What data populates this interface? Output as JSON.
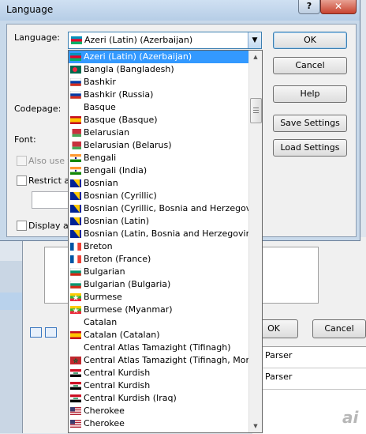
{
  "dialog": {
    "title": "Language",
    "help_glyph": "?",
    "close_glyph": "✕",
    "language_label": "Language:",
    "codepage_label": "Codepage:",
    "font_label": "Font:",
    "also_use_label": "Also use th",
    "restrict_label": "Restrict ac",
    "display_label": "Display ac",
    "selected_language": "Azeri (Latin) (Azerbaijan)",
    "selected_flag": "azerbaijan",
    "buttons": {
      "ok": "OK",
      "cancel": "Cancel",
      "help": "Help",
      "save": "Save Settings",
      "load": "Load Settings"
    }
  },
  "dropdown": {
    "items": [
      {
        "label": "Azeri (Latin) (Azerbaijan)",
        "flag": "azerbaijan",
        "selected": true
      },
      {
        "label": "Bangla (Bangladesh)",
        "flag": "bangladesh"
      },
      {
        "label": "Bashkir",
        "flag": "russia"
      },
      {
        "label": "Bashkir (Russia)",
        "flag": "russia"
      },
      {
        "label": "Basque",
        "flag": "none"
      },
      {
        "label": "Basque (Basque)",
        "flag": "spain"
      },
      {
        "label": "Belarusian",
        "flag": "belarus"
      },
      {
        "label": "Belarusian (Belarus)",
        "flag": "belarus"
      },
      {
        "label": "Bengali",
        "flag": "india"
      },
      {
        "label": "Bengali (India)",
        "flag": "india"
      },
      {
        "label": "Bosnian",
        "flag": "bosnia"
      },
      {
        "label": "Bosnian (Cyrillic)",
        "flag": "bosnia"
      },
      {
        "label": "Bosnian (Cyrillic, Bosnia and Herzegovina)",
        "flag": "bosnia"
      },
      {
        "label": "Bosnian (Latin)",
        "flag": "bosnia"
      },
      {
        "label": "Bosnian (Latin, Bosnia and Herzegovina)",
        "flag": "bosnia"
      },
      {
        "label": "Breton",
        "flag": "france"
      },
      {
        "label": "Breton (France)",
        "flag": "france"
      },
      {
        "label": "Bulgarian",
        "flag": "bulgaria"
      },
      {
        "label": "Bulgarian (Bulgaria)",
        "flag": "bulgaria"
      },
      {
        "label": "Burmese",
        "flag": "myanmar"
      },
      {
        "label": "Burmese (Myanmar)",
        "flag": "myanmar"
      },
      {
        "label": "Catalan",
        "flag": "none"
      },
      {
        "label": "Catalan (Catalan)",
        "flag": "spain"
      },
      {
        "label": "Central Atlas Tamazight (Tifinagh)",
        "flag": "none"
      },
      {
        "label": "Central Atlas Tamazight (Tifinagh, Morocco)",
        "flag": "morocco"
      },
      {
        "label": "Central Kurdish",
        "flag": "iraq"
      },
      {
        "label": "Central Kurdish",
        "flag": "iraq"
      },
      {
        "label": "Central Kurdish (Iraq)",
        "flag": "iraq"
      },
      {
        "label": "Cherokee",
        "flag": "usa"
      },
      {
        "label": "Cherokee",
        "flag": "usa"
      }
    ]
  },
  "background": {
    "ok": "OK",
    "cancel": "Cancel",
    "rows": [
      "Parser",
      "Parser"
    ]
  },
  "watermark": "ai",
  "colors": {
    "selection": "#3399ff",
    "close_button": "#c7432f"
  }
}
